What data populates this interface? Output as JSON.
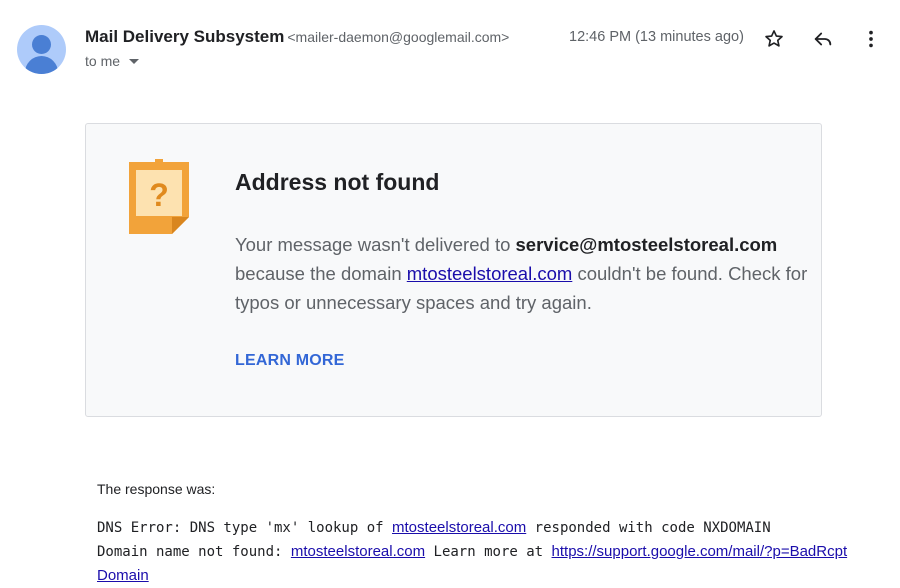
{
  "header": {
    "sender_name": "Mail Delivery Subsystem",
    "sender_email": "<mailer-daemon@googlemail.com>",
    "timestamp": "12:46 PM (13 minutes ago)",
    "to_label": "to me",
    "icons": [
      "avatar",
      "star-icon",
      "reply-icon",
      "more-vert-icon",
      "chevron-down-icon"
    ]
  },
  "card": {
    "title": "Address not found",
    "msg_part1": "Your message wasn't delivered to ",
    "recipient": "service@mtosteelstoreal.com",
    "msg_part2": " because the domain ",
    "domain": "mtosteelstoreal.com",
    "msg_part3": " couldn't be found. Check for typos or unnecessary spaces and try again.",
    "learn_more": "LEARN MORE",
    "icon": "question-note-icon"
  },
  "response": {
    "label": "The response was:",
    "line1_prefix": "DNS Error: DNS type 'mx' lookup of ",
    "line1_domain": "mtosteelstoreal.com",
    "line1_suffix": " responded with code NXDOMAIN",
    "line2_prefix": "Domain name not found: ",
    "line2_domain": "mtosteelstoreal.com",
    "line2_mid": " Learn more at ",
    "support_url": "https://support.google.com/mail/?p=BadRcptDomain"
  },
  "colors": {
    "accent": "#3367d6",
    "link": "#1a0dab",
    "icon_orange": "#f2a33a",
    "icon_light": "#fde2b0"
  }
}
